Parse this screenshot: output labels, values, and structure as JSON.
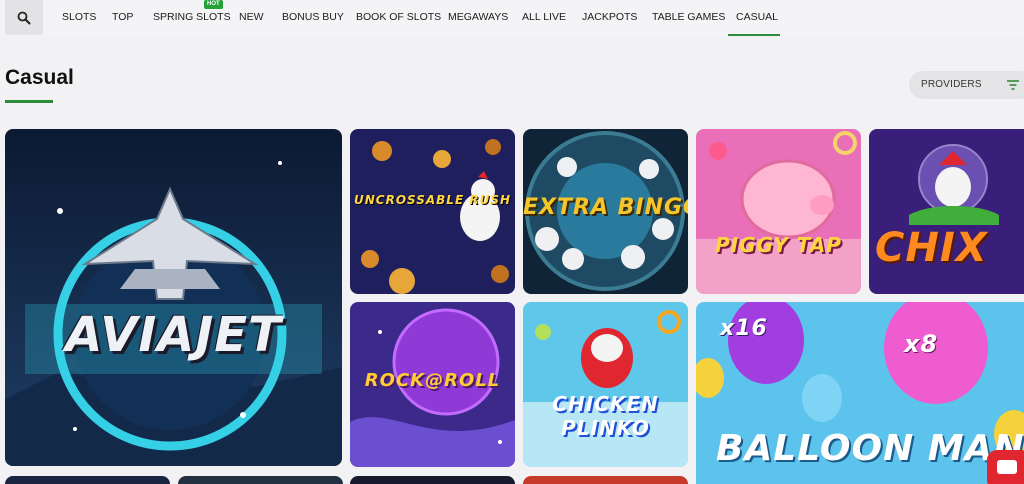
{
  "nav": {
    "items": [
      {
        "label": "SLOTS"
      },
      {
        "label": "TOP"
      },
      {
        "label": "SPRING SLOTS",
        "badge": "HOT"
      },
      {
        "label": "NEW"
      },
      {
        "label": "BONUS BUY"
      },
      {
        "label": "BOOK OF SLOTS"
      },
      {
        "label": "MEGAWAYS"
      },
      {
        "label": "ALL LIVE"
      },
      {
        "label": "JACKPOTS"
      },
      {
        "label": "TABLE GAMES"
      },
      {
        "label": "CASUAL",
        "active": true
      }
    ]
  },
  "page": {
    "title": "Casual"
  },
  "filter": {
    "providers_label": "PROVIDERS"
  },
  "games": [
    {
      "name": "AVIAJET"
    },
    {
      "name": "UNCROSSABLE RUSH"
    },
    {
      "name": "EXTRA BINGO"
    },
    {
      "name": "PIGGY TAP"
    },
    {
      "name": "CHIX"
    },
    {
      "name": "ROCK@ROLL"
    },
    {
      "name": "CHICKEN PLINKO"
    },
    {
      "name": "BALLOON MANIA",
      "balloon_labels": [
        "x16",
        "x8"
      ]
    }
  ],
  "colors": {
    "accent": "#2e8b3a",
    "hot_badge": "#23a33a",
    "chat": "#e0262f"
  }
}
